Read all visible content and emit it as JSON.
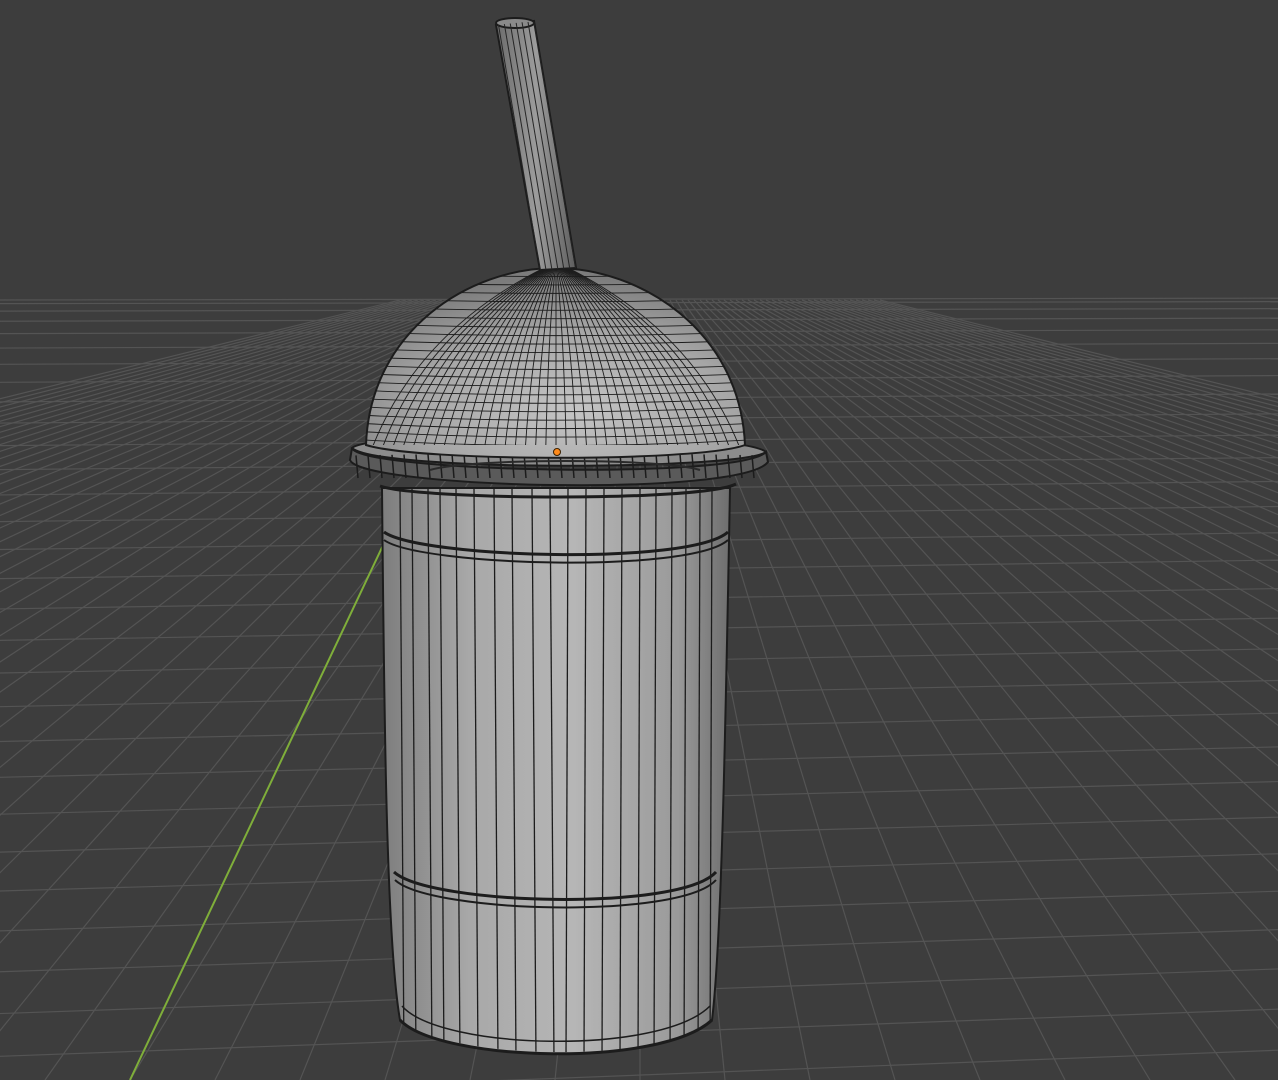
{
  "app": "3D viewport",
  "colors": {
    "background": "#3d3d3d",
    "grid": "#545454",
    "y_axis": "#7fae3a",
    "mesh_fill": "#a6a6a6",
    "wire": "#1c1c1c",
    "origin": "#ff8a1a"
  },
  "scene": {
    "object": "cup-with-dome-lid-and-straw",
    "view_mode": "wireframe-overlay",
    "object_origin_visible": true
  },
  "icons": {
    "origin": "origin-point-icon"
  }
}
